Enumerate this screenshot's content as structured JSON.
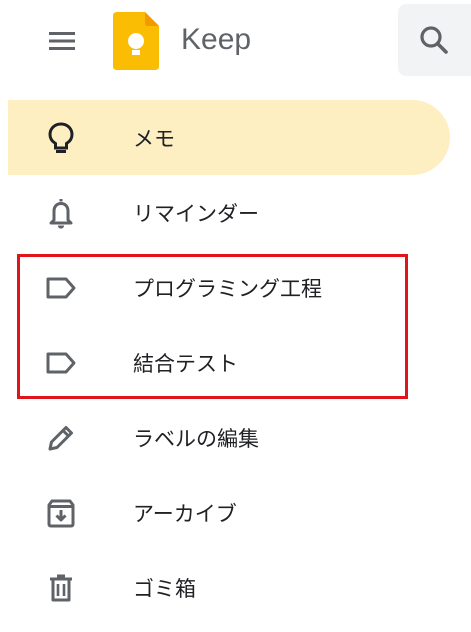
{
  "app": {
    "name": "Keep",
    "logo_icon": "keep-bulb-logo",
    "accent_color": "#fbbc04"
  },
  "header": {
    "menu_icon": "hamburger-menu-icon",
    "search_icon": "search-icon"
  },
  "sidebar": {
    "active_bg": "#feefc3",
    "items": [
      {
        "label": "メモ",
        "icon": "lightbulb-icon",
        "active": true
      },
      {
        "label": "リマインダー",
        "icon": "bell-icon",
        "active": false
      },
      {
        "label": "プログラミング工程",
        "icon": "label-icon",
        "active": false
      },
      {
        "label": "結合テスト",
        "icon": "label-icon",
        "active": false
      },
      {
        "label": "ラベルの編集",
        "icon": "pencil-icon",
        "active": false
      },
      {
        "label": "アーカイブ",
        "icon": "archive-icon",
        "active": false
      },
      {
        "label": "ゴミ箱",
        "icon": "trash-icon",
        "active": false
      }
    ]
  },
  "annotation": {
    "highlight_color": "#e0151b"
  }
}
